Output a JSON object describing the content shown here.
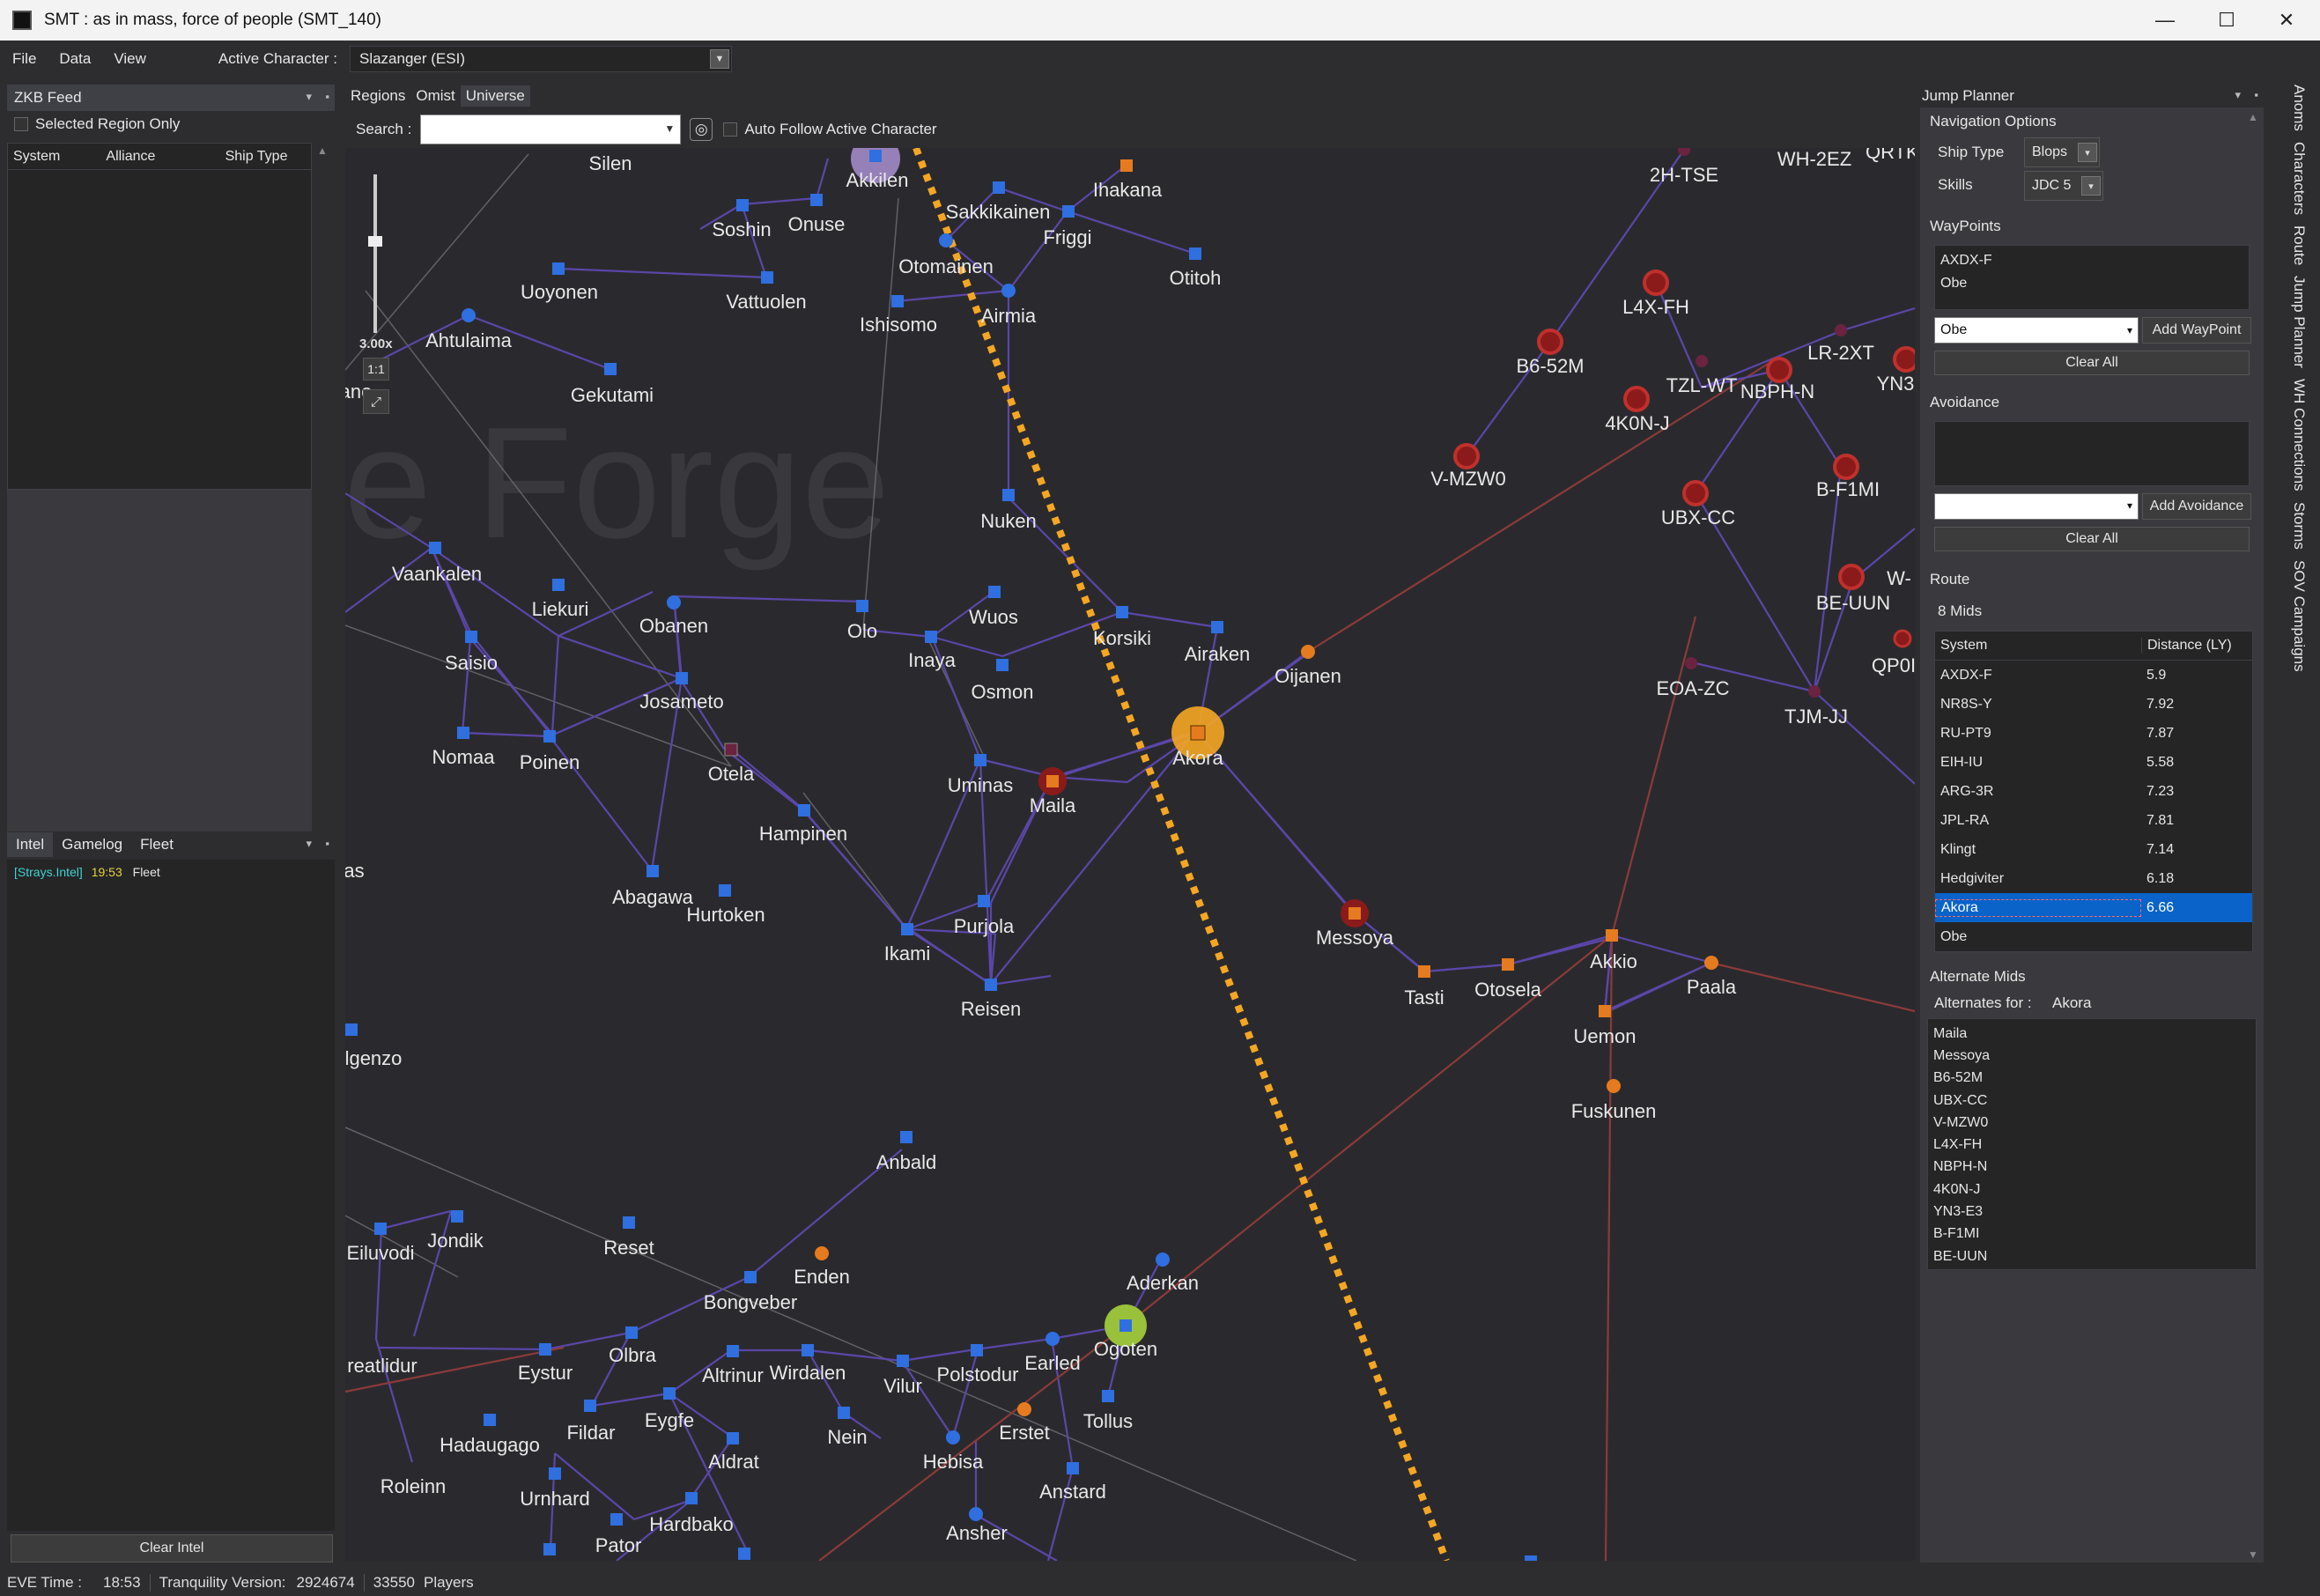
{
  "window": {
    "title": "SMT : as in mass, force of people (SMT_140)",
    "minimize": "—",
    "maximize": "☐",
    "close": "✕"
  },
  "menu": {
    "file": "File",
    "data": "Data",
    "view": "View",
    "active_character_label": "Active Character :",
    "active_character_value": "Slazanger (ESI)"
  },
  "zkb": {
    "title": "ZKB Feed",
    "selected_region_only": "Selected Region Only",
    "columns": [
      "System",
      "Alliance",
      "Ship Type"
    ]
  },
  "intel": {
    "tabs": [
      "Intel",
      "Gamelog",
      "Fleet"
    ],
    "entry": {
      "channel": "[Strays.Intel]",
      "time": "19:53",
      "text": "Fleet"
    },
    "clear_button": "Clear Intel"
  },
  "map_tabs": [
    "Regions",
    "Omist",
    "Universe"
  ],
  "search": {
    "label": "Search :",
    "value": "",
    "auto_follow": "Auto Follow Active Character"
  },
  "zoom": {
    "value": "3.00x",
    "one_to_one": "1:1"
  },
  "region_watermark": "e Forge",
  "systems": [
    {
      "name": "Silen"
    },
    {
      "name": "Akkilen"
    },
    {
      "name": "Ihakana"
    },
    {
      "name": "Soshin"
    },
    {
      "name": "Onuse"
    },
    {
      "name": "Sakkikainen"
    },
    {
      "name": "Friggi"
    },
    {
      "name": "Otomainen"
    },
    {
      "name": "Otitoh"
    },
    {
      "name": "Uoyonen"
    },
    {
      "name": "Vattuolen"
    },
    {
      "name": "Ishisomo"
    },
    {
      "name": "Airmia"
    },
    {
      "name": "Ahtulaima"
    },
    {
      "name": "Gekutami"
    },
    {
      "name": "Nuken"
    },
    {
      "name": "Vaankalen"
    },
    {
      "name": "Liekuri"
    },
    {
      "name": "Obanen"
    },
    {
      "name": "Olo"
    },
    {
      "name": "Wuos"
    },
    {
      "name": "Korsiki"
    },
    {
      "name": "Airaken"
    },
    {
      "name": "Oijanen"
    },
    {
      "name": "Inaya"
    },
    {
      "name": "Osmon"
    },
    {
      "name": "Saisio"
    },
    {
      "name": "Josameto"
    },
    {
      "name": "Nomaa"
    },
    {
      "name": "Poinen"
    },
    {
      "name": "Otela"
    },
    {
      "name": "Uminas"
    },
    {
      "name": "Maila"
    },
    {
      "name": "Akora"
    },
    {
      "name": "Hampinen"
    },
    {
      "name": "Abagawa"
    },
    {
      "name": "Hurtoken"
    },
    {
      "name": "Purjola"
    },
    {
      "name": "Ikami"
    },
    {
      "name": "Reisen"
    },
    {
      "name": "Messoya"
    },
    {
      "name": "Tasti"
    },
    {
      "name": "Otosela"
    },
    {
      "name": "Akkio"
    },
    {
      "name": "Paala"
    },
    {
      "name": "Uemon"
    },
    {
      "name": "Fuskunen"
    },
    {
      "name": "Anbald"
    },
    {
      "name": "Jondik"
    },
    {
      "name": "Eiluvodi"
    },
    {
      "name": "Reset"
    },
    {
      "name": "Enden"
    },
    {
      "name": "Aderkan"
    },
    {
      "name": "Bongveber"
    },
    {
      "name": "Ogoten"
    },
    {
      "name": "Olbra"
    },
    {
      "name": "Eystur"
    },
    {
      "name": "Altrinur"
    },
    {
      "name": "Wirdalen"
    },
    {
      "name": "Vilur"
    },
    {
      "name": "Polstodur"
    },
    {
      "name": "Earled"
    },
    {
      "name": "Tollus"
    },
    {
      "name": "Hadaugago"
    },
    {
      "name": "Fildar"
    },
    {
      "name": "Eygfe"
    },
    {
      "name": "Nein"
    },
    {
      "name": "Erstet"
    },
    {
      "name": "Aldrat"
    },
    {
      "name": "Hebisa"
    },
    {
      "name": "Roleinn"
    },
    {
      "name": "Urnhard"
    },
    {
      "name": "Anstard"
    },
    {
      "name": "Hardbako"
    },
    {
      "name": "Ansher"
    },
    {
      "name": "Pator"
    },
    {
      "name": "reatlidur"
    },
    {
      "name": "lgenzo"
    },
    {
      "name": "as"
    },
    {
      "name": "ane"
    },
    {
      "name": "2H-TSE"
    },
    {
      "name": "WH-2EZ"
    },
    {
      "name": "QRTK-"
    },
    {
      "name": "L4X-FH"
    },
    {
      "name": "B6-52M"
    },
    {
      "name": "LR-2XT"
    },
    {
      "name": "TZL-WT"
    },
    {
      "name": "NBPH-N"
    },
    {
      "name": "YN3"
    },
    {
      "name": "4K0N-J"
    },
    {
      "name": "V-MZW0"
    },
    {
      "name": "UBX-CC"
    },
    {
      "name": "B-F1MI"
    },
    {
      "name": "BE-UUN"
    },
    {
      "name": "W-"
    },
    {
      "name": "EOA-ZC"
    },
    {
      "name": "TJM-JJ"
    },
    {
      "name": "QP0I"
    }
  ],
  "jump_planner": {
    "title": "Jump Planner",
    "nav_options": "Navigation Options",
    "ship_type_label": "Ship Type",
    "ship_type_value": "Blops",
    "skills_label": "Skills",
    "skills_value": "JDC 5",
    "waypoints_label": "WayPoints",
    "waypoints": [
      "AXDX-F",
      "Obe"
    ],
    "waypoint_select": "Obe",
    "add_waypoint": "Add WayPoint",
    "clear_all": "Clear All",
    "avoidance_label": "Avoidance",
    "add_avoidance": "Add Avoidance",
    "route_label": "Route",
    "mids": "8 Mids",
    "route_columns": [
      "System",
      "Distance (LY)"
    ],
    "route": [
      {
        "system": "AXDX-F",
        "distance": "5.9"
      },
      {
        "system": "NR8S-Y",
        "distance": "7.92"
      },
      {
        "system": "RU-PT9",
        "distance": "7.87"
      },
      {
        "system": "EIH-IU",
        "distance": "5.58"
      },
      {
        "system": "ARG-3R",
        "distance": "7.23"
      },
      {
        "system": "JPL-RA",
        "distance": "7.81"
      },
      {
        "system": "Klingt",
        "distance": "7.14"
      },
      {
        "system": "Hedgiviter",
        "distance": "6.18"
      },
      {
        "system": "Akora",
        "distance": "6.66"
      },
      {
        "system": "Obe",
        "distance": ""
      }
    ],
    "alternate_mids": "Alternate Mids",
    "alternates_for_label": "Alternates for :",
    "alternates_for_value": "Akora",
    "alternates": [
      "Maila",
      "Messoya",
      "B6-52M",
      "UBX-CC",
      "V-MZW0",
      "L4X-FH",
      "NBPH-N",
      "4K0N-J",
      "YN3-E3",
      "B-F1MI",
      "BE-UUN"
    ]
  },
  "side_tabs": [
    "Anoms",
    "Characters",
    "Route",
    "Jump Planner",
    "WH Connections",
    "Storms",
    "SOV Campaigns"
  ],
  "status": {
    "eve_time_label": "EVE Time :",
    "eve_time": "18:53",
    "version_label": "Tranquility Version:",
    "version": "2924674",
    "players": "33550",
    "players_label": "Players"
  }
}
